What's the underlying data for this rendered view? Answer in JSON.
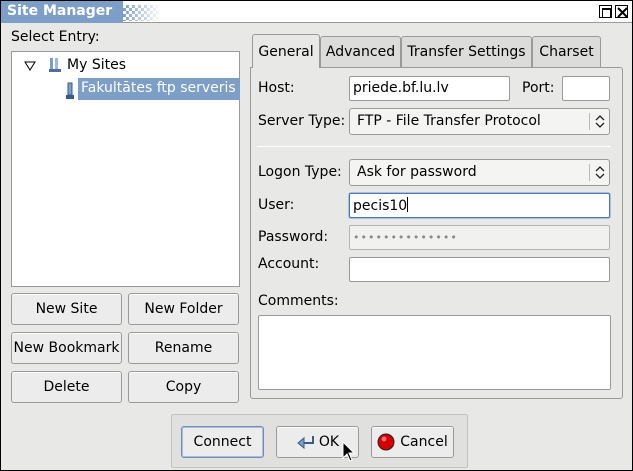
{
  "window": {
    "title": "Site Manager"
  },
  "left": {
    "select_entry_label": "Select Entry:",
    "tree": {
      "root_label": "My Sites",
      "child_label": "Fakultātes ftp serveris"
    },
    "buttons": {
      "new_site": "New Site",
      "new_folder": "New Folder",
      "new_bookmark": "New Bookmark",
      "rename": "Rename",
      "delete": "Delete",
      "copy": "Copy"
    }
  },
  "tabs": [
    {
      "label": "General",
      "active": true
    },
    {
      "label": "Advanced",
      "active": false
    },
    {
      "label": "Transfer Settings",
      "active": false
    },
    {
      "label": "Charset",
      "active": false
    }
  ],
  "general": {
    "host_label": "Host:",
    "host_value": "priede.bf.lu.lv",
    "port_label": "Port:",
    "port_value": "",
    "server_type_label": "Server Type:",
    "server_type_value": "FTP - File Transfer Protocol",
    "logon_type_label": "Logon Type:",
    "logon_type_value": "Ask for password",
    "user_label": "User:",
    "user_value": "pecis10",
    "password_label": "Password:",
    "password_value": "••••••••••••••",
    "account_label": "Account:",
    "account_value": "",
    "comments_label": "Comments:"
  },
  "footer": {
    "connect": "Connect",
    "ok": "OK",
    "cancel": "Cancel"
  },
  "colors": {
    "selection": "#7d9ec7",
    "window_bg": "#e8e8e7",
    "cancel_icon": "#d40000"
  }
}
